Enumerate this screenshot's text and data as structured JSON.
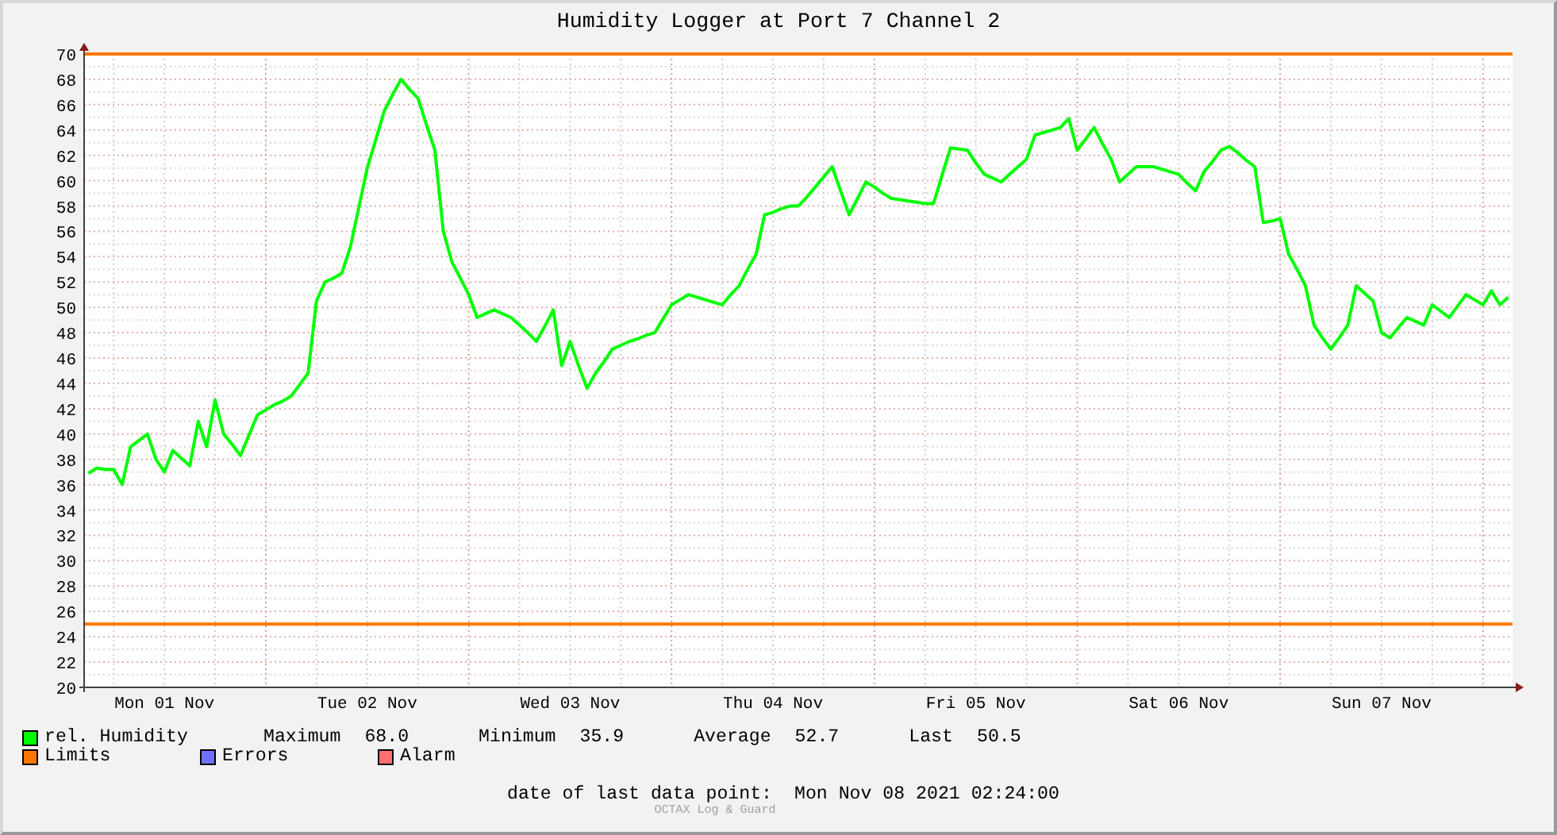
{
  "title": "Humidity Logger at Port 7 Channel 2",
  "chart": {
    "chart_data": {
      "type": "line",
      "ylim": [
        20,
        70
      ],
      "categories": [
        null,
        null,
        null,
        null,
        null,
        null,
        null,
        null,
        null,
        "Mon 01 Nov",
        null,
        null,
        null,
        null,
        null,
        null,
        null,
        null,
        null,
        null,
        null,
        null,
        null,
        null,
        null,
        null,
        null,
        null,
        null,
        null,
        null,
        null,
        null,
        "Tue 02 Nov",
        null,
        null,
        null,
        null,
        null,
        null,
        null,
        null,
        null,
        null,
        null,
        null,
        null,
        null,
        null,
        null,
        null,
        null,
        null,
        null,
        null,
        null,
        null,
        "Wed 03 Nov",
        null,
        null,
        null,
        null,
        null,
        null,
        null,
        null,
        null,
        null,
        null,
        null,
        null,
        null,
        null,
        null,
        null,
        null,
        null,
        null,
        null,
        null,
        null,
        "Thu 04 Nov",
        null,
        null,
        null,
        null,
        null,
        null,
        null,
        null,
        null,
        null,
        null,
        null,
        null,
        null,
        null,
        null,
        null,
        null,
        null,
        null,
        null,
        null,
        null,
        "Fri 05 Nov",
        null,
        null,
        null,
        null,
        null,
        null,
        null,
        null,
        null,
        null,
        null,
        null,
        null,
        null,
        null,
        null,
        null,
        null,
        null,
        null,
        null,
        null,
        null,
        "Sat 06 Nov",
        null,
        null,
        null,
        null,
        null,
        null,
        null,
        null,
        null,
        null,
        null,
        null,
        null,
        null,
        null,
        null,
        null,
        null,
        null,
        null,
        null,
        null,
        null,
        "Sun 07 Nov",
        null,
        null,
        null,
        null,
        null,
        null,
        null,
        null,
        null,
        null,
        null,
        null,
        null,
        null,
        null
      ],
      "yticks": [
        20,
        22,
        24,
        26,
        28,
        30,
        32,
        34,
        36,
        38,
        40,
        42,
        44,
        46,
        48,
        50,
        52,
        54,
        56,
        58,
        60,
        62,
        64,
        66,
        68,
        70
      ],
      "series": [
        {
          "name": "rel. Humidity",
          "color": "#00ff00",
          "values": [
            36.9,
            37.3,
            37.2,
            37.2,
            36,
            39,
            39.5,
            40,
            38,
            37,
            38.7,
            38.1,
            37.5,
            41,
            39,
            42.7,
            40,
            39.2,
            38.3,
            39.9,
            41.5,
            41.9,
            42.3,
            42.6,
            43,
            43.9,
            44.8,
            50.5,
            52,
            52.3,
            52.7,
            54.8,
            57.9,
            61,
            63.2,
            65.5,
            66.8,
            68,
            67.2,
            66.5,
            64.4,
            62.4,
            56,
            53.6,
            52.3,
            51,
            49.2,
            49.5,
            49.8,
            49.5,
            49.2,
            48.6,
            48,
            47.3,
            48.5,
            49.8,
            45.4,
            47.3,
            45.4,
            43.6,
            44.8,
            45.7,
            46.7,
            47,
            47.3,
            47.5,
            47.8,
            48,
            49.1,
            50.2,
            50.6,
            51,
            50.8,
            50.6,
            50.4,
            50.2,
            51,
            51.7,
            53,
            54.2,
            57.3,
            57.5,
            57.8,
            58,
            58,
            58.7,
            59.5,
            60.3,
            61.1,
            59.2,
            57.3,
            58.6,
            59.9,
            59.5,
            59,
            58.6,
            58.5,
            58.4,
            58.3,
            58.2,
            58.2,
            60.4,
            62.6,
            62.5,
            62.4,
            61.4,
            60.5,
            60.2,
            59.9,
            60.5,
            61.1,
            61.7,
            63.6,
            63.8,
            64,
            64.2,
            64.9,
            62.4,
            63.3,
            64.2,
            62.9,
            61.7,
            59.9,
            60.5,
            61.1,
            61.1,
            61.1,
            60.9,
            60.7,
            60.5,
            59.8,
            59.2,
            60.7,
            61.5,
            62.4,
            62.7,
            62.2,
            61.6,
            61.1,
            56.7,
            56.8,
            57,
            54.2,
            53,
            51.7,
            48.6,
            47.6,
            46.7,
            47.6,
            48.6,
            51.7,
            51.1,
            50.5,
            48,
            47.6,
            48.4,
            49.2,
            48.9,
            48.6,
            50.2,
            49.7,
            49.2,
            50.1,
            51,
            50.6,
            50.2,
            51.3,
            50.2,
            50.8
          ]
        }
      ],
      "ref_lines": [
        {
          "axis": "y",
          "value": 70
        },
        {
          "axis": "y",
          "value": 25
        }
      ],
      "grid": true
    }
  },
  "stats": [
    {
      "label": "Maximum",
      "value": "68.0"
    },
    {
      "label": "Minimum",
      "value": "35.9"
    },
    {
      "label": "Average",
      "value": "52.7"
    },
    {
      "label": "Last",
      "value": "50.5"
    }
  ],
  "legend": [
    {
      "label": "Limits",
      "color": "#ff7700"
    },
    {
      "label": "Errors",
      "color": "#7070ff"
    },
    {
      "label": "Alarm",
      "color": "#ff7070"
    }
  ],
  "last_data_point": {
    "label": "date of last data point:",
    "value": "Mon Nov 08 2021 02:24:00"
  },
  "credit": "OCTAX Log & Guard"
}
